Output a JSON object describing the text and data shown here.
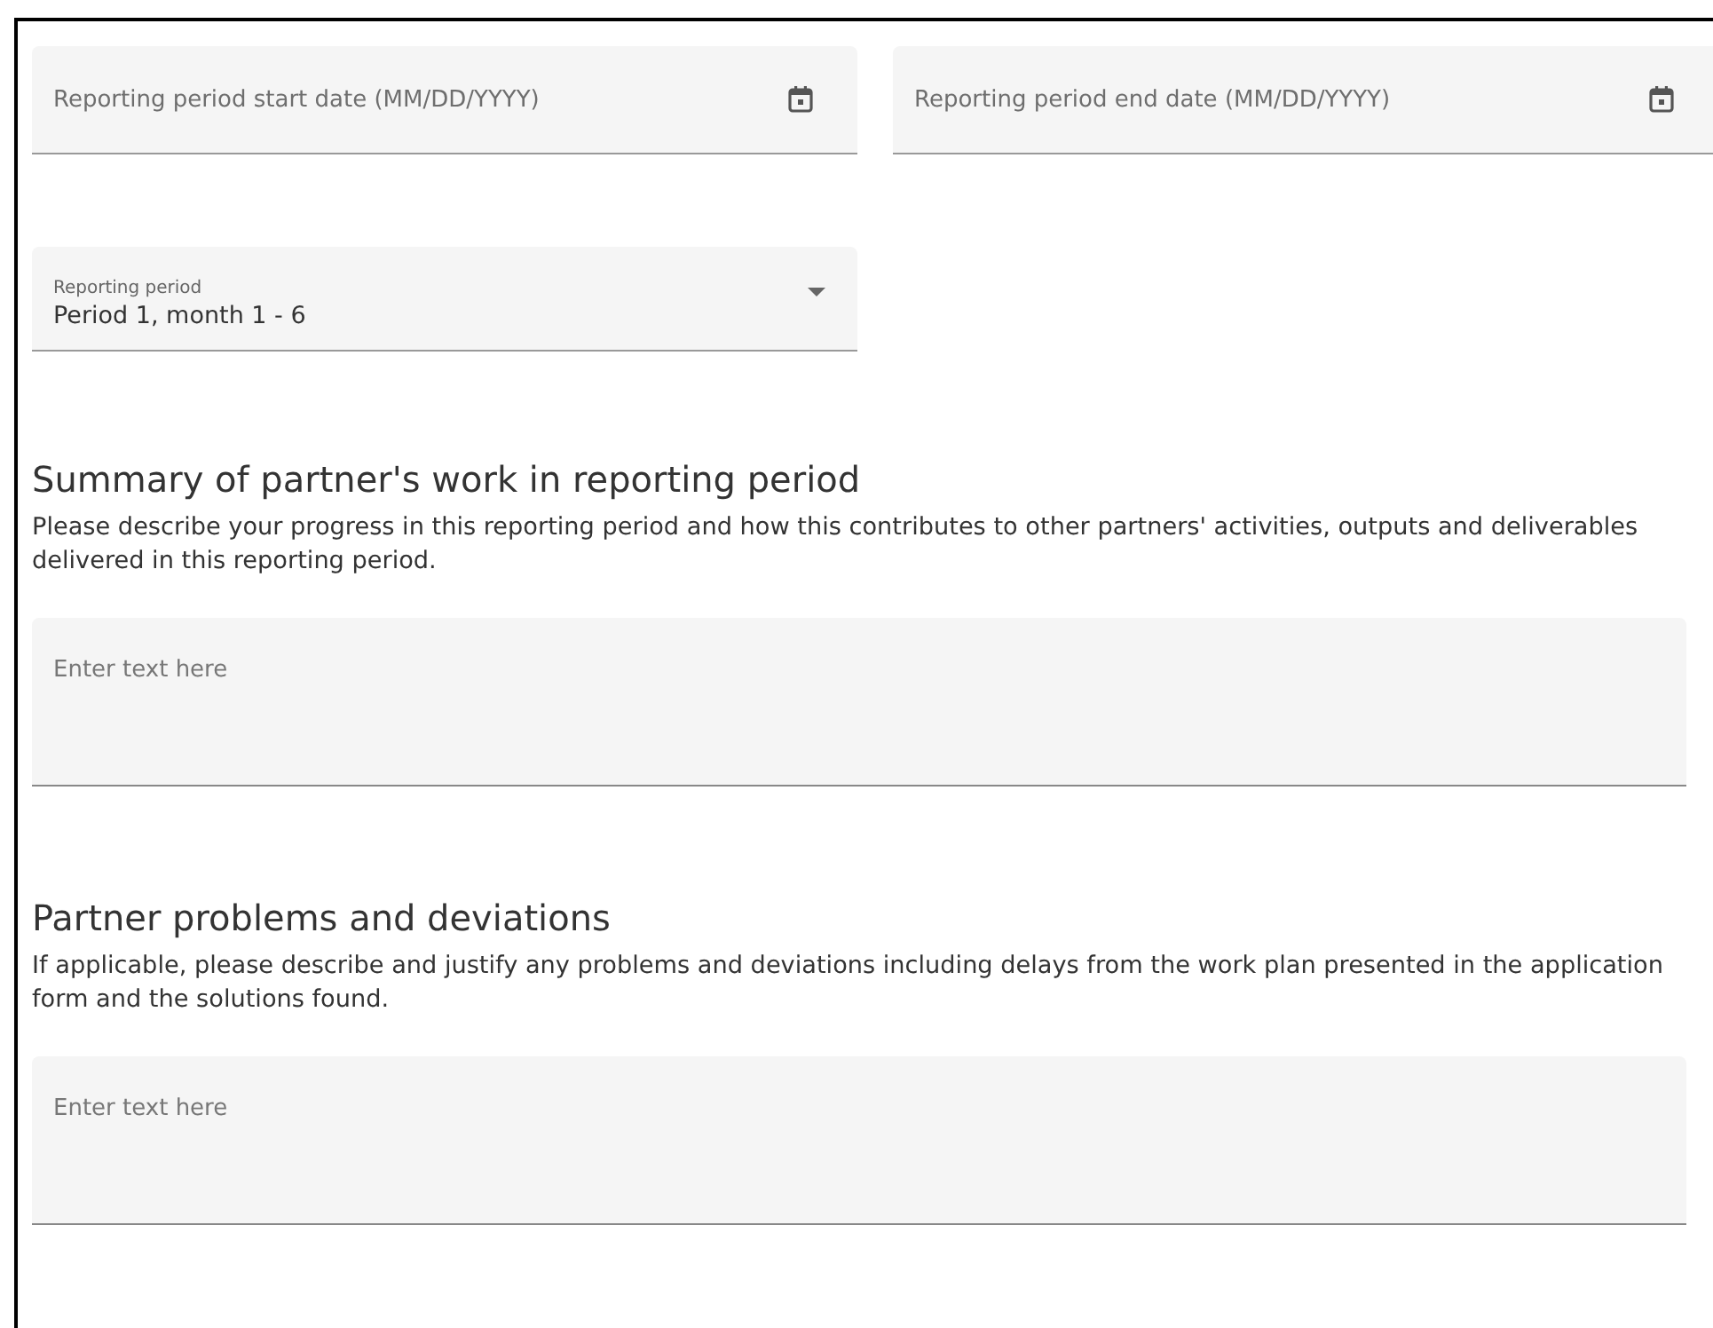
{
  "date_fields": [
    {
      "placeholder": "Reporting period start date (MM/DD/YYYY)"
    },
    {
      "placeholder": "Reporting period end date (MM/DD/YYYY)"
    }
  ],
  "period_select": {
    "label": "Reporting period",
    "value": "Period 1, month 1 - 6"
  },
  "sections": [
    {
      "title": "Summary of partner's work in reporting period",
      "description": "Please describe your progress in this reporting period and how this contributes to other partners' activities, outputs and deliverables delivered in this reporting period.",
      "placeholder": "Enter text here"
    },
    {
      "title": "Partner problems and deviations",
      "description": "If applicable, please describe and justify any problems and deviations including delays from the work plan presented in the application form and the solutions found.",
      "placeholder": "Enter text here"
    }
  ]
}
